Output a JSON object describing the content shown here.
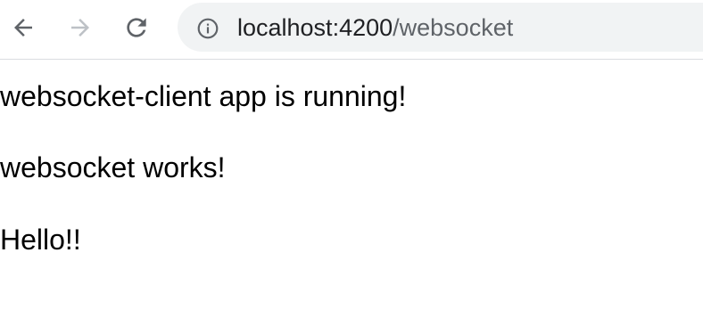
{
  "browser": {
    "url_host": "localhost:4200",
    "url_path": "/websocket",
    "icons": {
      "back": "back-arrow-icon",
      "forward": "forward-arrow-icon",
      "reload": "reload-icon",
      "site_info": "info-icon"
    },
    "colors": {
      "toolbar_icon": "#5f6368",
      "toolbar_icon_disabled": "#bdc1c6",
      "omnibox_bg": "#f1f3f4"
    }
  },
  "page": {
    "lines": [
      "websocket-client app is running!",
      "websocket works!",
      "Hello!!"
    ]
  }
}
